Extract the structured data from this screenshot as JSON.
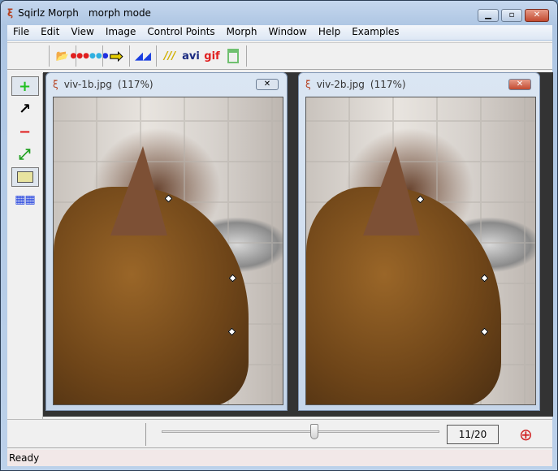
{
  "app": {
    "title": "Sqirlz Morph",
    "mode": "morph mode"
  },
  "menu": [
    "File",
    "Edit",
    "View",
    "Image",
    "Control Points",
    "Morph",
    "Window",
    "Help",
    "Examples"
  ],
  "toolbar": {
    "avi_label": "avi",
    "gif_label": "gif",
    "icons": [
      "open-folder-icon",
      "control-points-icon",
      "arrow-right-icon",
      "triangle-icon",
      "warp-icon",
      "avi-icon",
      "gif-icon",
      "window-icon"
    ]
  },
  "left_tools": [
    "add-point-icon",
    "move-arrow-icon",
    "remove-point-icon",
    "move-all-icon",
    "rectangle-icon",
    "grid-icon"
  ],
  "children": [
    {
      "title": "viv-1b.jpg",
      "zoom": "(117%)"
    },
    {
      "title": "viv-2b.jpg",
      "zoom": "(117%)"
    }
  ],
  "slider": {
    "frame": 11,
    "total": 20,
    "label": "11/20"
  },
  "status": "Ready"
}
